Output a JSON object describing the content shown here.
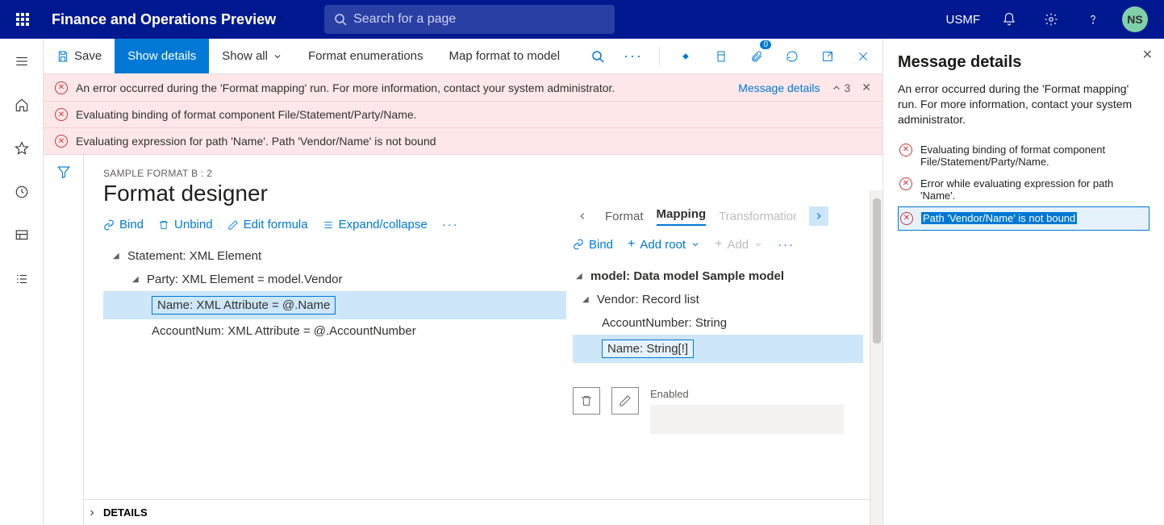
{
  "header": {
    "app_title": "Finance and Operations Preview",
    "search_placeholder": "Search for a page",
    "company": "USMF",
    "avatar_initials": "NS"
  },
  "toolbar": {
    "save": "Save",
    "show_details": "Show details",
    "show_all": "Show all",
    "format_enum": "Format enumerations",
    "map_format": "Map format to model",
    "attach_badge": "0"
  },
  "errors": {
    "msg1": "An error occurred during the 'Format mapping' run. For more information, contact your system administrator.",
    "msg2": "Evaluating binding of format component File/Statement/Party/Name.",
    "msg3": "Evaluating expression for path 'Name'.   Path 'Vendor/Name' is not bound",
    "link": "Message details",
    "count": "3"
  },
  "designer": {
    "crumb": "SAMPLE FORMAT B : 2",
    "title": "Format designer",
    "actions": {
      "bind": "Bind",
      "unbind": "Unbind",
      "edit_formula": "Edit formula",
      "expand": "Expand/collapse"
    },
    "tree": {
      "n1": "Statement: XML Element",
      "n2": "Party: XML Element = model.Vendor",
      "n3": "Name: XML Attribute = @.Name",
      "n4": "AccountNum: XML Attribute = @.AccountNumber"
    },
    "details_label": "DETAILS"
  },
  "right": {
    "tabs": {
      "format": "Format",
      "mapping": "Mapping",
      "trans": "Transformations"
    },
    "actions": {
      "bind": "Bind",
      "add_root": "Add root",
      "add": "Add"
    },
    "tree": {
      "n1": "model: Data model Sample model",
      "n2": "Vendor: Record list",
      "n3": "AccountNumber: String",
      "n4": "Name: String[!]"
    },
    "enabled_label": "Enabled"
  },
  "panel": {
    "title": "Message details",
    "desc": "An error occurred during the 'Format mapping' run. For more information, contact your system administrator.",
    "i1": "Evaluating binding of format component File/Statement/Party/Name.",
    "i2": "Error while evaluating expression for path 'Name'.",
    "i3": "Path 'Vendor/Name' is not bound"
  }
}
